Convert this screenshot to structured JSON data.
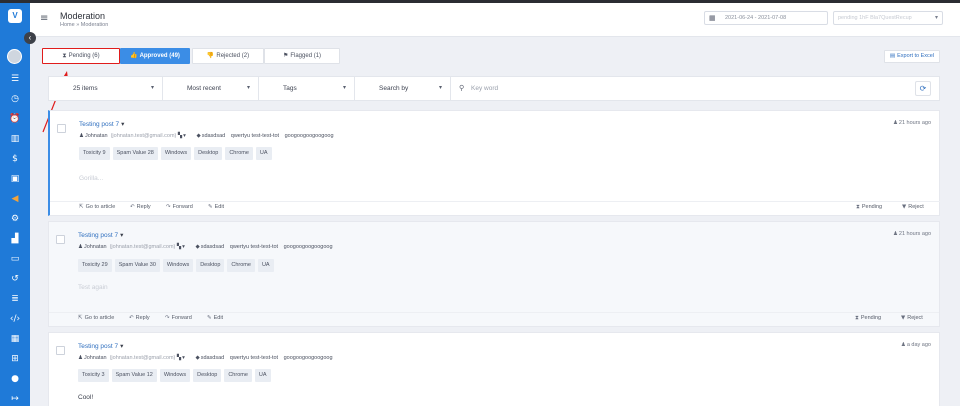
{
  "sidebar": {
    "logo": "V",
    "toggle": "‹",
    "icons": [
      "list-icon",
      "clock-icon",
      "alarm-icon",
      "book-icon",
      "dollar-icon",
      "image-icon",
      "megaphone-icon",
      "gear-icon",
      "chart-icon",
      "card-icon",
      "history-icon",
      "rows-icon",
      "code-icon",
      "building-icon",
      "sitemap-icon",
      "chat-icon",
      "logout-icon"
    ]
  },
  "header": {
    "menu_icon": "≡",
    "title": "Moderation",
    "breadcrumb": "Home  »  Moderation",
    "date_range": "2021-06-24 - 2021-07-08",
    "date_icon": "▦",
    "source_placeholder": "pending 1hF Bla7QuestRecup",
    "source_chevron": "▾"
  },
  "tabs": [
    {
      "icon": "⧗",
      "label": "Pending (6)"
    },
    {
      "icon": "👍",
      "label": "Approved (49)"
    },
    {
      "icon": "👎",
      "label": "Rejected (2)"
    },
    {
      "icon": "⚑",
      "label": "Flagged (1)"
    }
  ],
  "export_label": "Export to Excel",
  "export_icon": "▤",
  "filters": {
    "items": "25 items",
    "sort": "Most recent",
    "tags": "Tags",
    "search_by": "Search by",
    "keyword_placeholder": "Key word",
    "chevron": "▾",
    "search_icon": "⚲",
    "refresh_icon": "⟳"
  },
  "posts": [
    {
      "title": "Testing post 7",
      "author": "Johnatan",
      "email": "(johnatan.test@gmail.com)",
      "tags": [
        "sdasdsad",
        "qwertyu test-test-tot",
        "googoogoogoogoog"
      ],
      "time": "21 hours ago",
      "chips": [
        "Toxicity 9",
        "Spam Value 28",
        "Windows",
        "Desktop",
        "Chrome",
        "UA"
      ],
      "text": "Gorilla...",
      "actions": {
        "goto": "Go to article",
        "reply": "Reply",
        "forward": "Forward",
        "edit": "Edit",
        "status": "Pending",
        "reject": "Reject"
      }
    },
    {
      "title": "Testing post 7",
      "author": "Johnatan",
      "email": "(johnatan.test@gmail.com)",
      "tags": [
        "sdasdsad",
        "qwertyu test-test-tot",
        "googoogoogoogoog"
      ],
      "time": "21 hours ago",
      "chips": [
        "Toxicity 29",
        "Spam Value 30",
        "Windows",
        "Desktop",
        "Chrome",
        "UA"
      ],
      "text": "Test again",
      "actions": {
        "goto": "Go to article",
        "reply": "Reply",
        "forward": "Forward",
        "edit": "Edit",
        "status": "Pending",
        "reject": "Reject"
      }
    },
    {
      "title": "Testing post 7",
      "author": "Johnatan",
      "email": "(johnatan.test@gmail.com)",
      "tags": [
        "sdasdsad",
        "qwertyu test-test-tot",
        "googoogoogoogoog"
      ],
      "time": "a day ago",
      "chips": [
        "Toxicity 3",
        "Spam Value 12",
        "Windows",
        "Desktop",
        "Chrome",
        "UA"
      ],
      "text": "Cool!"
    }
  ]
}
